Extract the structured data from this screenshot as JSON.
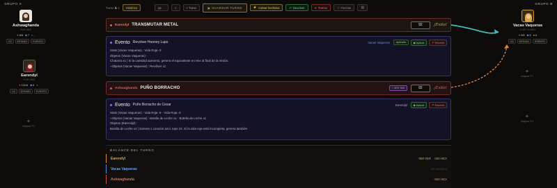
{
  "groups": {
    "a": {
      "title": "GRUPO A"
    },
    "b": {
      "title": "GRUPO B"
    }
  },
  "players": {
    "ashwaghanda": {
      "name": "Ashwaghanda",
      "sub": "3VE HEX",
      "hearts": "6/8",
      "blue": "7",
      "yellow": "-",
      "tags": [
        "X2",
        "ESTADO",
        "EVENTO"
      ]
    },
    "earendyl": {
      "name": "Earendyl",
      "sub": "3 VE HEX",
      "hearts": "13/16",
      "blue": "6",
      "yellow": "-",
      "tags": [
        "X2",
        "ESTADO",
        "EVENTO"
      ]
    },
    "vacas": {
      "name": "Vacas Vaqueras",
      "sub": "0 VE / 0 HEX",
      "hearts": "6/8",
      "blue": "5",
      "yellow": "6",
      "tags": [
        "X2",
        "ESTADO",
        "EVENTO"
      ]
    }
  },
  "slots": {
    "add_label": "Asignar PJ"
  },
  "toolbar": {
    "turn_label": "Turno",
    "turn_current": "1",
    "turn_total": "2",
    "historic": "Histórico",
    "select_value": "ya",
    "prev": "<",
    "next_turn": "+ Turno",
    "save": "GUARDAR TURNO",
    "cobrar": "Cobrar hechizos",
    "devolver": "Devolver",
    "turnos": "Turnos",
    "flechas": "Flechas"
  },
  "actions": [
    {
      "who": "Earendyl",
      "title": "TRANSMUTAR METAL",
      "value": "92",
      "result": "¡Éxito!",
      "badge": ""
    },
    {
      "who": "Ashwaghanda",
      "title": "PUÑO BORRACHO",
      "value": "92",
      "result": "¡Éxito!",
      "badge": "+ VEX 300"
    }
  ],
  "events": [
    {
      "label": "Evento",
      "name": "Revolver Hooney Lups",
      "target": "Vacas Vaqueras",
      "applied": "aplicado",
      "apply": "Aplicar",
      "revert": "Revertir",
      "lines": [
        "Stats (Vacas Vaqueras) : Vida Roja -3",
        "Objetos (Vacas Vaqueras) :",
        "Chatarra x1 | Si la cantidad aumento, genera el equivalente en Hex al final de la misión.",
        "~Objetos (Vacas Vaqueras) : Revólver x1"
      ]
    },
    {
      "label": "Evento",
      "name": "Puño Borracho de Cesar",
      "target": "Earendyl",
      "applied": "",
      "apply": "Aplicar",
      "revert": "Revertir",
      "lines": [
        "Stats (Vacas Vaqueras) : Vida Roja -5 · Vida Roja -3",
        "~Objetos (Vacas Vaqueras) : Botella de Leche x1 · Botella de Leche x1",
        "Objetos (Earendyl) :",
        "Botella de Leche x2 | Genera 1 corazón azul, tope 24. Si la vida roja está incompleta, genera también"
      ]
    }
  ],
  "balance": {
    "title": "BALANCE DEL TURNO",
    "rows": [
      {
        "name": "Earendyl",
        "vex": "-300 VEX",
        "hex": "-250 HEX"
      },
      {
        "name": "Vacas Vaqueras",
        "vex": "",
        "hex": "sin cambios"
      },
      {
        "name": "Ashwaghanda",
        "vex": "",
        "hex": "-800 HEX"
      }
    ]
  },
  "colors": {
    "teal_arrow": "#3fc0b8",
    "orange_arrow": "#e8863a"
  },
  "icons": [
    "heart-icon",
    "shield-icon",
    "coin-icon",
    "save-icon",
    "bolt-icon",
    "undo-icon",
    "link-icon",
    "plus-icon"
  ]
}
